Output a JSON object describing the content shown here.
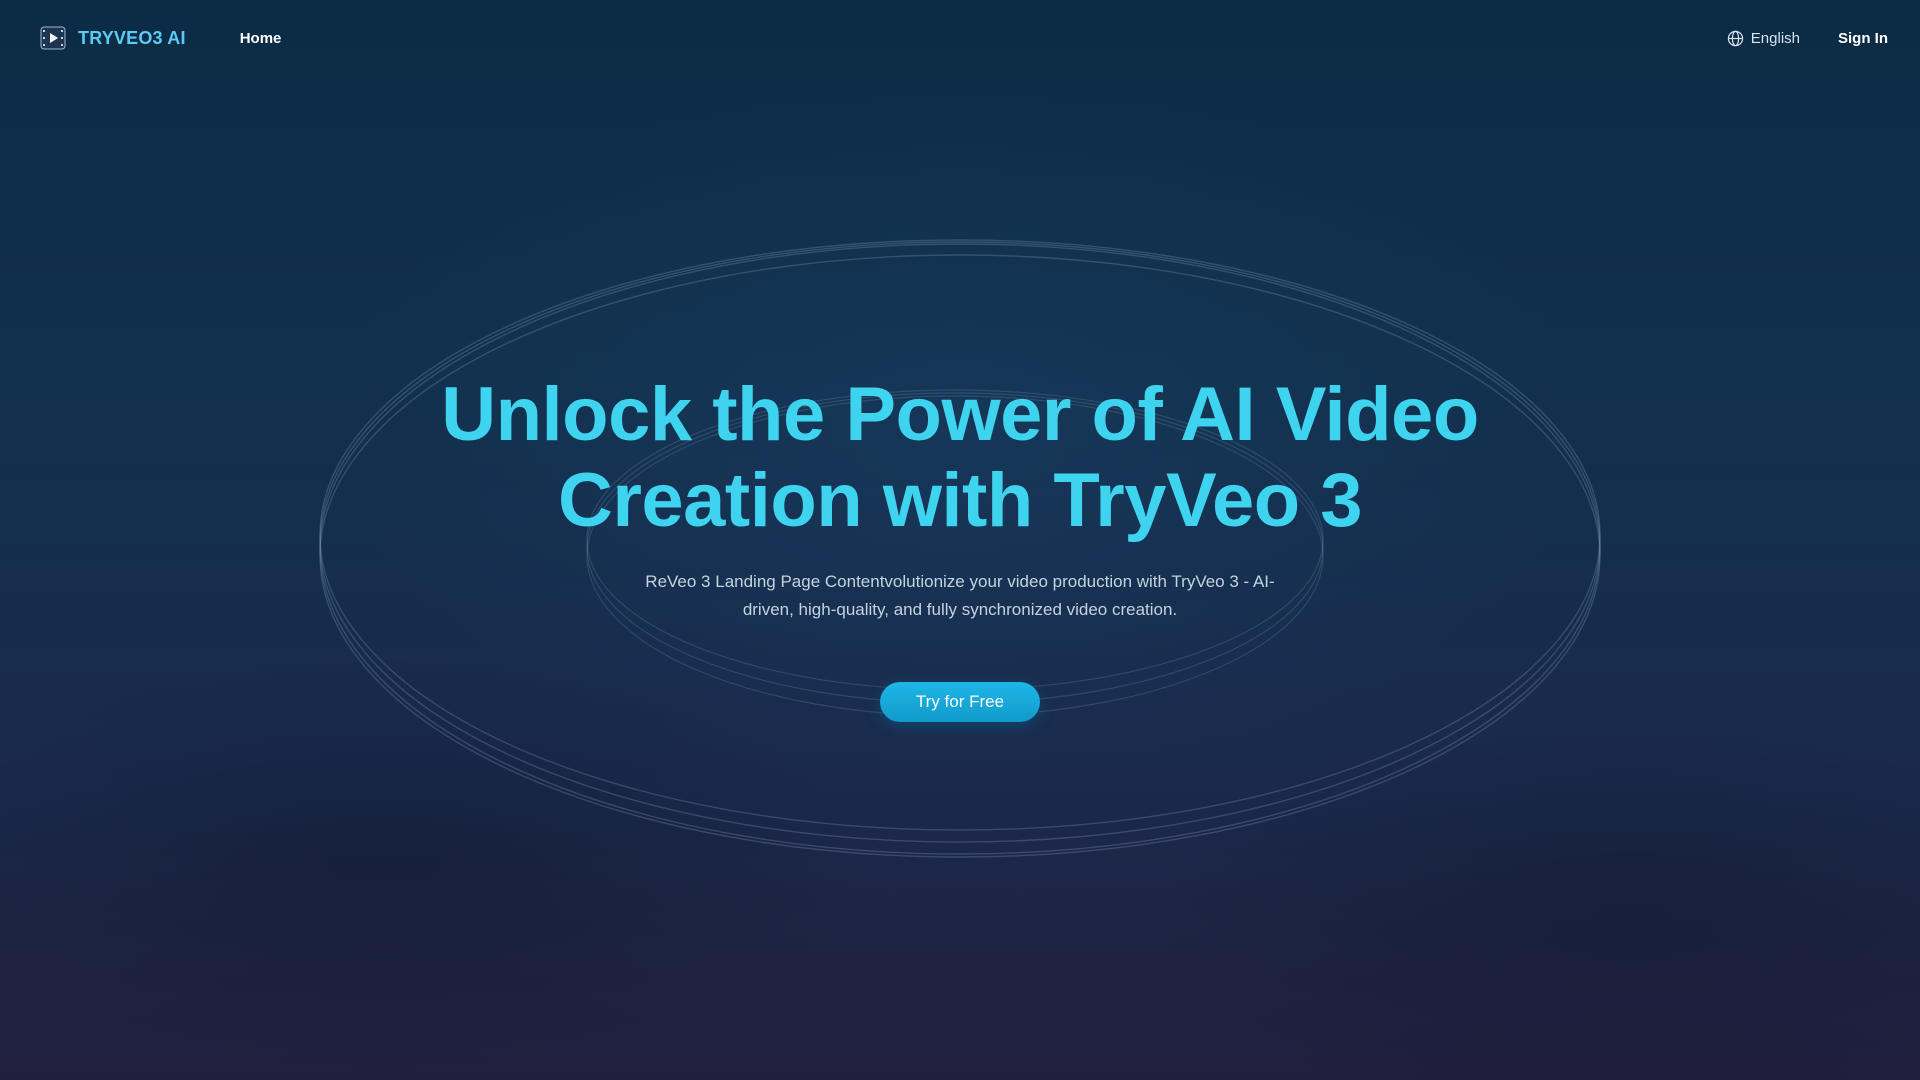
{
  "header": {
    "brand": "TRYVEO3 AI",
    "logo_icon": "video-play-icon",
    "nav": [
      {
        "label": "Home"
      }
    ],
    "language": {
      "icon": "globe-icon",
      "label": "English"
    },
    "sign_in_label": "Sign In"
  },
  "hero": {
    "title_line1": "Unlock the Power of AI Video",
    "title_line2": "Creation with TryVeo 3",
    "description": "ReVeo 3 Landing Page Contentvolutionize your video production with TryVeo 3 - AI-driven, high-quality, and fully synchronized video creation.",
    "cta_label": "Try for Free"
  },
  "colors": {
    "accent": "#3ed3ee",
    "brand": "#5ccbf3",
    "button": "#1fb6e6",
    "background_top": "#0c2b45",
    "background_bottom": "#211f3e"
  }
}
